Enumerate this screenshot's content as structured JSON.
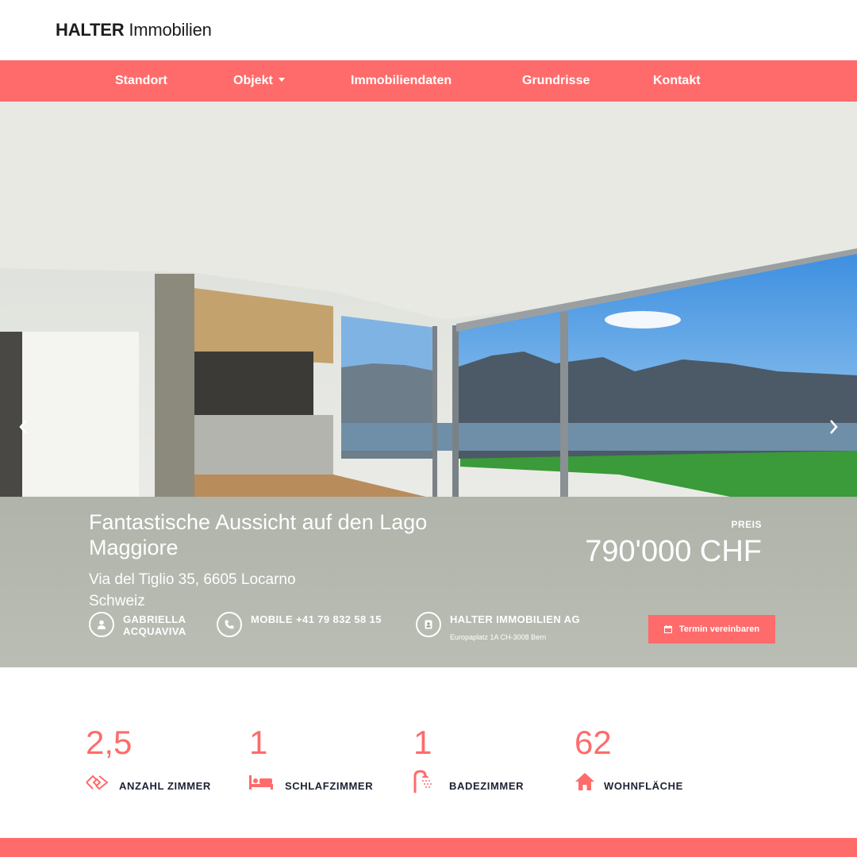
{
  "brand": {
    "bold": "HALTER",
    "light": "Immobilien"
  },
  "nav": {
    "items": [
      {
        "label": "Standort"
      },
      {
        "label": "Objekt"
      },
      {
        "label": "Immobiliendaten"
      },
      {
        "label": "Grundrisse"
      },
      {
        "label": "Kontakt"
      }
    ]
  },
  "hero": {
    "title": "Fantastische Aussicht auf den Lago Maggiore",
    "address_line1": "Via del Tiglio 35, 6605 Locarno",
    "address_line2": "Schweiz",
    "price_label": "PREIS",
    "price": "790'000 CHF",
    "contacts": {
      "person_line1": "GABRIELLA",
      "person_line2": "ACQUAVIVA",
      "phone": "MOBILE +41 79 832 58 15",
      "company": "HALTER IMMOBILIEN AG",
      "company_address": "Europaplatz 1A CH-3008 Bern"
    },
    "cta_label": "Termin vereinbaren"
  },
  "stats": [
    {
      "value": "2,5",
      "label": "ANZAHL ZIMMER",
      "icon": "rooms-icon"
    },
    {
      "value": "1",
      "label": "SCHLAFZIMMER",
      "icon": "bed-icon"
    },
    {
      "value": "1",
      "label": "BADEZIMMER",
      "icon": "shower-icon"
    },
    {
      "value": "62",
      "label": "WOHNFLÄCHE",
      "icon": "home-icon"
    }
  ],
  "colors": {
    "accent": "#ff6b6b",
    "text_dark": "#1d2233"
  }
}
